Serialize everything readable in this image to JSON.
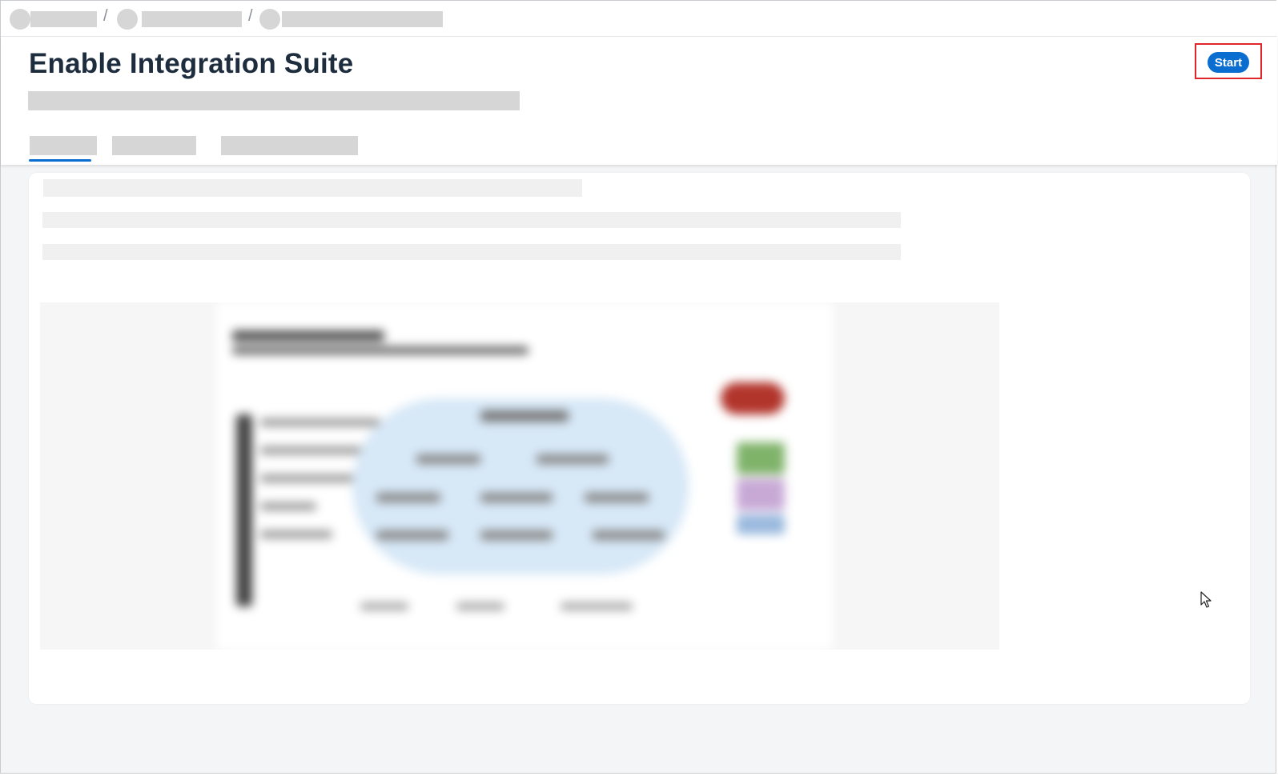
{
  "page": {
    "title": "Enable Integration Suite"
  },
  "breadcrumb": {
    "separator": "/"
  },
  "header": {
    "start_label": "Start",
    "accent_color": "#0a6ed1",
    "highlight_color": "#e0252b"
  }
}
